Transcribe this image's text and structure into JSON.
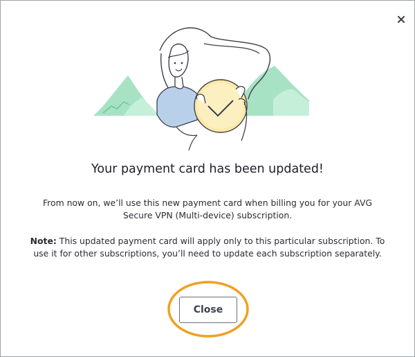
{
  "dialog": {
    "close_icon": "close-icon",
    "title": "Your payment card has been updated!",
    "message": "From now on, we’ll use this new payment card when billing you for your AVG Secure VPN (Multi-device) subscription.",
    "note_label": "Note:",
    "note_text": " This updated payment card will apply only to this particular subscription. To use it for other subscriptions, you’ll need to update each subscription separately.",
    "close_button_label": "Close"
  },
  "colors": {
    "highlight_ring": "#f0a020",
    "mountain": "#9edcbc",
    "coin": "#fbe7a6",
    "shirt": "#b6cde8"
  }
}
